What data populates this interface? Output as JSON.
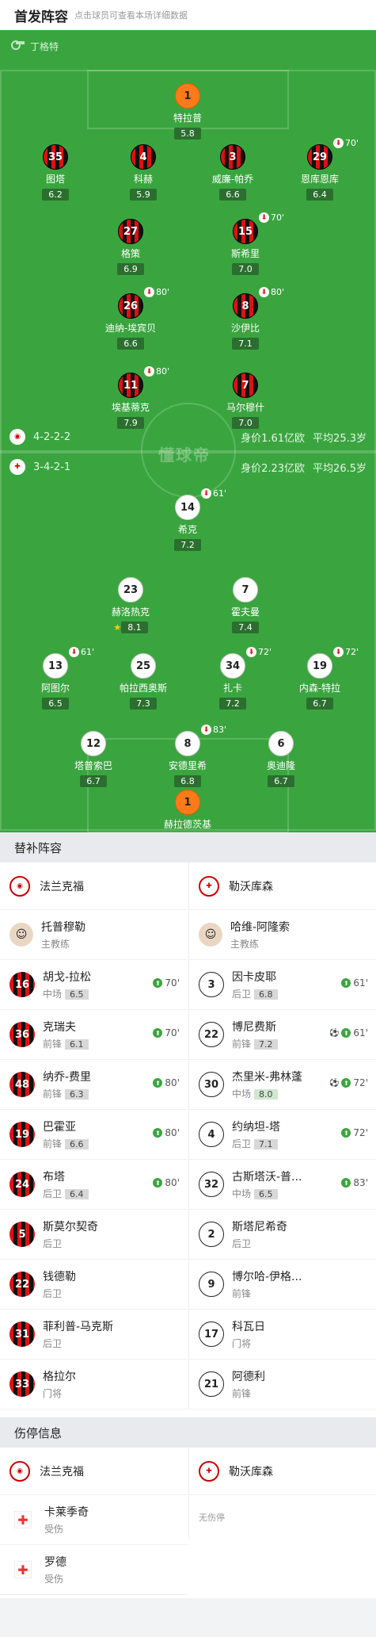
{
  "header": {
    "title": "首发阵容",
    "subtitle": "点击球员可查看本场详细数据"
  },
  "referee": "丁格特",
  "watermark": "懂球帝",
  "home_bar": {
    "formation": "4-2-2-2",
    "value": "身价1.61亿欧",
    "age": "平均25.3岁"
  },
  "away_bar": {
    "formation": "3-4-2-1",
    "value": "身价2.23亿欧",
    "age": "平均26.5岁"
  },
  "home_players": [
    {
      "num": "1",
      "name": "特拉普",
      "rating": "5.8",
      "gk": true,
      "captain": true
    },
    {
      "num": "35",
      "name": "图塔",
      "rating": "6.2"
    },
    {
      "num": "4",
      "name": "科赫",
      "rating": "5.9"
    },
    {
      "num": "3",
      "name": "威廉-帕乔",
      "rating": "6.6"
    },
    {
      "num": "29",
      "name": "恩库恩库",
      "rating": "6.4",
      "sub": "70'"
    },
    {
      "num": "27",
      "name": "格策",
      "rating": "6.9"
    },
    {
      "num": "15",
      "name": "斯希里",
      "rating": "7.0",
      "sub": "70'"
    },
    {
      "num": "26",
      "name": "迪纳-埃宾贝",
      "rating": "6.6",
      "sub": "80'"
    },
    {
      "num": "8",
      "name": "沙伊比",
      "rating": "7.1",
      "sub": "80'"
    },
    {
      "num": "11",
      "name": "埃基蒂克",
      "rating": "7.9",
      "sub": "80'",
      "goal": true
    },
    {
      "num": "7",
      "name": "马尔穆什",
      "rating": "7.0"
    }
  ],
  "away_players": [
    {
      "num": "14",
      "name": "希克",
      "rating": "7.2",
      "sub": "61'",
      "goal": true
    },
    {
      "num": "23",
      "name": "赫洛热克",
      "rating": "8.1",
      "best": true
    },
    {
      "num": "7",
      "name": "霍夫曼",
      "rating": "7.4"
    },
    {
      "num": "13",
      "name": "阿图尔",
      "rating": "6.5",
      "sub": "61'"
    },
    {
      "num": "25",
      "name": "帕拉西奥斯",
      "rating": "7.3",
      "goal": true
    },
    {
      "num": "34",
      "name": "扎卡",
      "rating": "7.2",
      "sub": "72'",
      "goal": true
    },
    {
      "num": "19",
      "name": "内森-特拉",
      "rating": "6.7",
      "sub": "72'"
    },
    {
      "num": "12",
      "name": "塔普索巴",
      "rating": "6.7"
    },
    {
      "num": "8",
      "name": "安德里希",
      "rating": "6.8",
      "sub": "83'"
    },
    {
      "num": "6",
      "name": "奥迪隆",
      "rating": "6.7"
    },
    {
      "num": "1",
      "name": "赫拉德茨基",
      "rating": "7.2",
      "gk": true,
      "captain": true
    }
  ],
  "subs": {
    "title": "替补阵容",
    "home_team": "法兰克福",
    "away_team": "勒沃库森",
    "home_coach": {
      "name": "托普穆勒",
      "role": "主教练"
    },
    "away_coach": {
      "name": "哈维-阿隆索",
      "role": "主教练"
    },
    "home": [
      {
        "num": "16",
        "name": "胡戈-拉松",
        "pos": "中场",
        "rating": "6.5",
        "time": "70'"
      },
      {
        "num": "36",
        "name": "克瑞夫",
        "pos": "前锋",
        "rating": "6.1",
        "time": "70'"
      },
      {
        "num": "48",
        "name": "纳乔-费里",
        "pos": "前锋",
        "rating": "6.3",
        "time": "80'"
      },
      {
        "num": "19",
        "name": "巴霍亚",
        "pos": "前锋",
        "rating": "6.6",
        "time": "80'"
      },
      {
        "num": "24",
        "name": "布塔",
        "pos": "后卫",
        "rating": "6.4",
        "time": "80'"
      },
      {
        "num": "5",
        "name": "斯莫尔契奇",
        "pos": "后卫"
      },
      {
        "num": "22",
        "name": "钱德勒",
        "pos": "后卫"
      },
      {
        "num": "31",
        "name": "菲利普-马克斯",
        "pos": "后卫"
      },
      {
        "num": "33",
        "name": "格拉尔",
        "pos": "门将"
      }
    ],
    "away": [
      {
        "num": "3",
        "name": "因卡皮耶",
        "pos": "后卫",
        "rating": "6.8",
        "time": "61'"
      },
      {
        "num": "22",
        "name": "博尼费斯",
        "pos": "前锋",
        "rating": "7.2",
        "time": "61'",
        "goal": true
      },
      {
        "num": "30",
        "name": "杰里米-弗林蓬",
        "pos": "中场",
        "rating": "8.0",
        "time": "72'",
        "goal": true,
        "hi": true
      },
      {
        "num": "4",
        "name": "约纳坦-塔",
        "pos": "后卫",
        "rating": "7.1",
        "time": "72'"
      },
      {
        "num": "32",
        "name": "古斯塔沃-普...",
        "pos": "中场",
        "rating": "6.5",
        "time": "83'"
      },
      {
        "num": "2",
        "name": "斯塔尼希奇",
        "pos": "后卫"
      },
      {
        "num": "9",
        "name": "博尔哈-伊格...",
        "pos": "前锋"
      },
      {
        "num": "17",
        "name": "科瓦日",
        "pos": "门将"
      },
      {
        "num": "21",
        "name": "阿德利",
        "pos": "前锋"
      }
    ]
  },
  "injuries": {
    "title": "伤停信息",
    "home_team": "法兰克福",
    "away_team": "勒沃库森",
    "home": [
      {
        "name": "卡莱季奇",
        "status": "受伤"
      },
      {
        "name": "罗德",
        "status": "受伤"
      }
    ],
    "away_none": "无伤停"
  }
}
